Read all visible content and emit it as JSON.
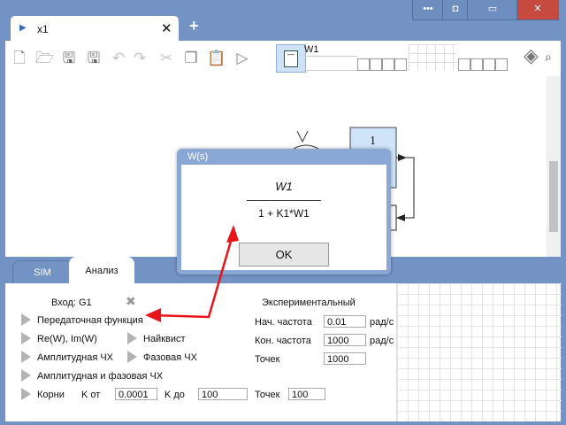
{
  "window": {
    "controls": [
      "•••",
      "◘",
      "▭",
      "✕"
    ]
  },
  "tab": {
    "label": "x1",
    "close": "✕",
    "new": "+"
  },
  "toolbar": {
    "icons": [
      "new-file-icon",
      "open-folder-icon",
      "save-icon",
      "save-as-icon",
      "undo-icon",
      "redo-icon",
      "cut-icon",
      "copy-icon",
      "paste-icon",
      "run-icon"
    ],
    "transfer_name": "W1",
    "block_glyph": "1",
    "fit_glyph": "◈",
    "zoom_glyph": "⌕"
  },
  "canvas": {
    "block_value": "1"
  },
  "dialog": {
    "title": "W(s)",
    "numerator": "W1",
    "denominator": "1 + K1*W1",
    "ok": "OK"
  },
  "panel": {
    "tabs": [
      "SIM",
      "Анализ"
    ],
    "input_label": "Вход: G1",
    "transfer_fn": "Передаточная функция",
    "re_im": "Re(W), Im(W)",
    "nyquist": "Найквист",
    "amp": "Амплитудная ЧХ",
    "phase": "Фазовая ЧХ",
    "amp_phase": "Амплитудная и фазовая ЧХ",
    "roots": "Корни",
    "k_from_label": "K от",
    "k_from": "0.0001",
    "k_to_label": "K до",
    "k_to": "100",
    "points_label": "Точек",
    "points": "100",
    "experimental": "Экспериментальный",
    "start_freq_label": "Нач. частота",
    "start_freq": "0.01",
    "end_freq_label": "Кон. частота",
    "end_freq": "1000",
    "unit": "рад/с",
    "exp_points_label": "Точек",
    "exp_points": "1000"
  }
}
